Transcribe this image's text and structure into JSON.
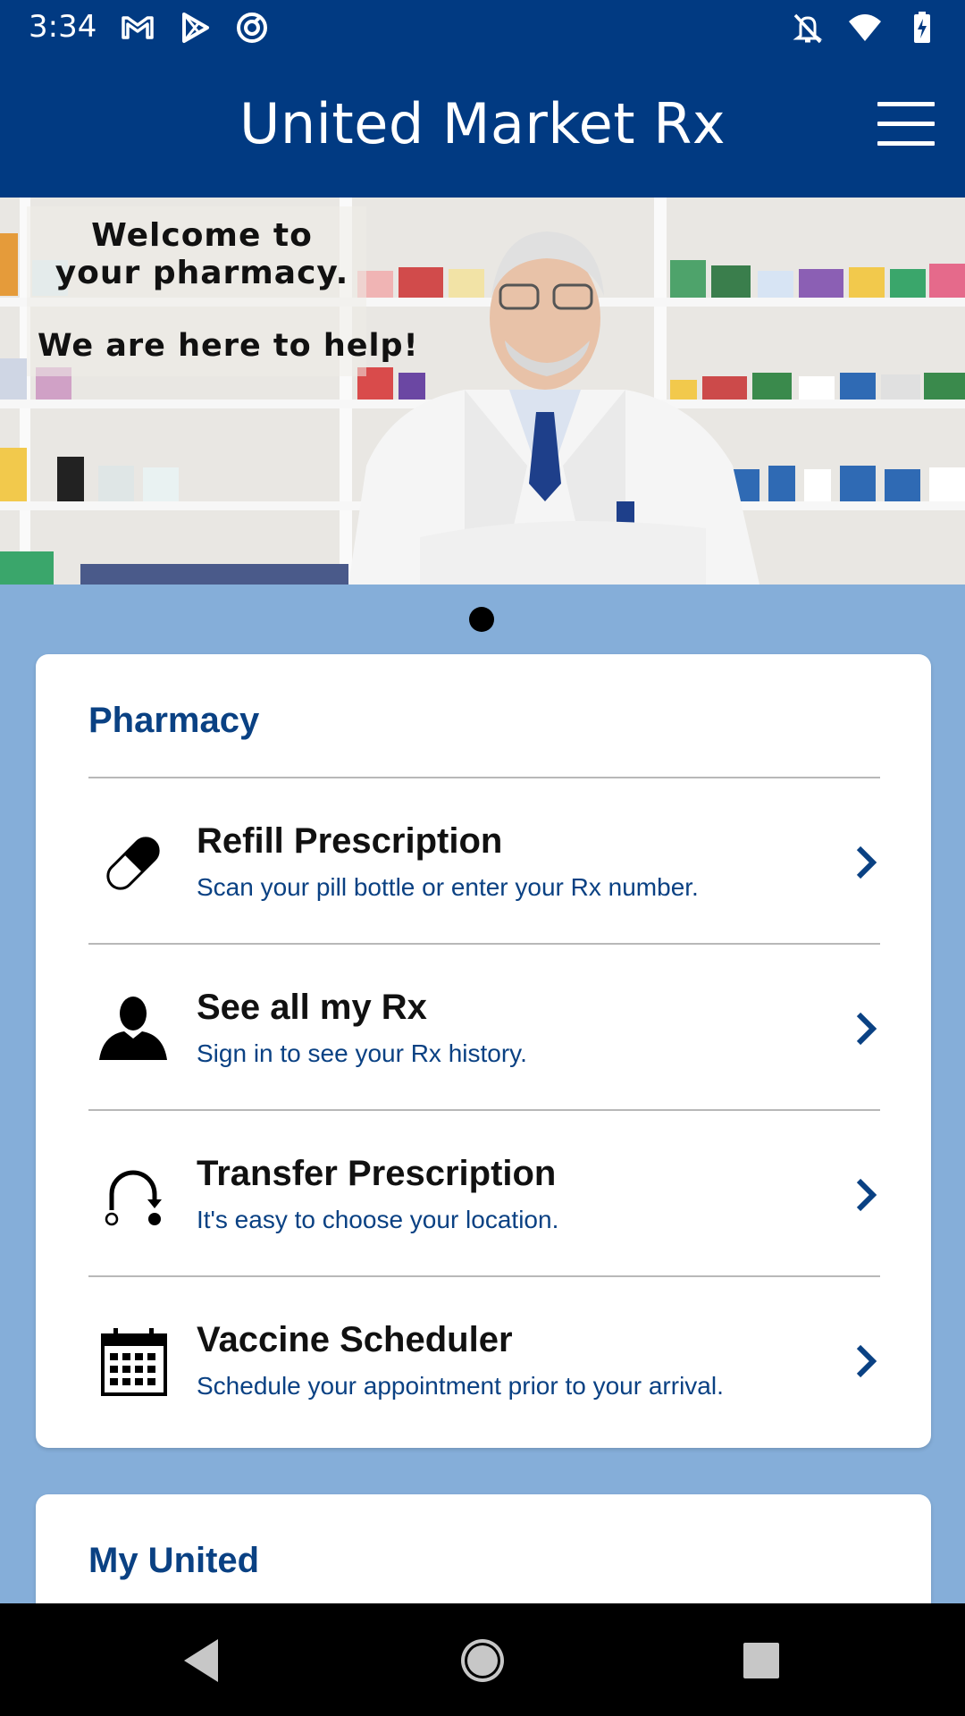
{
  "status_bar": {
    "time": "3:34",
    "left_icons": [
      "gmail-icon",
      "play-store-icon",
      "sync-icon"
    ],
    "right_icons": [
      "notifications-off-icon",
      "wifi-icon",
      "battery-icon"
    ]
  },
  "header": {
    "title": "United Market Rx",
    "menu_icon": "hamburger-menu-icon"
  },
  "hero": {
    "line1": "Welcome to your pharmacy.",
    "line2": "We are here to help!",
    "carousel_count": 1,
    "carousel_active": 0
  },
  "pharmacy_card": {
    "title": "Pharmacy",
    "items": [
      {
        "icon": "pill-icon",
        "title": "Refill Prescription",
        "subtitle": "Scan your pill bottle or enter your Rx number."
      },
      {
        "icon": "person-icon",
        "title": "See all my Rx",
        "subtitle": "Sign in to see your Rx history."
      },
      {
        "icon": "transfer-icon",
        "title": "Transfer Prescription",
        "subtitle": "It's easy to choose your location."
      },
      {
        "icon": "calendar-icon",
        "title": "Vaccine Scheduler",
        "subtitle": "Schedule your appointment prior to your arrival."
      }
    ]
  },
  "my_united_card": {
    "title": "My United"
  },
  "nav_bar": {
    "buttons": [
      "back-icon",
      "home-icon",
      "recents-icon"
    ]
  },
  "colors": {
    "brand_blue": "#013a82",
    "background": "#85aed9",
    "accent_text": "#0a4183"
  }
}
